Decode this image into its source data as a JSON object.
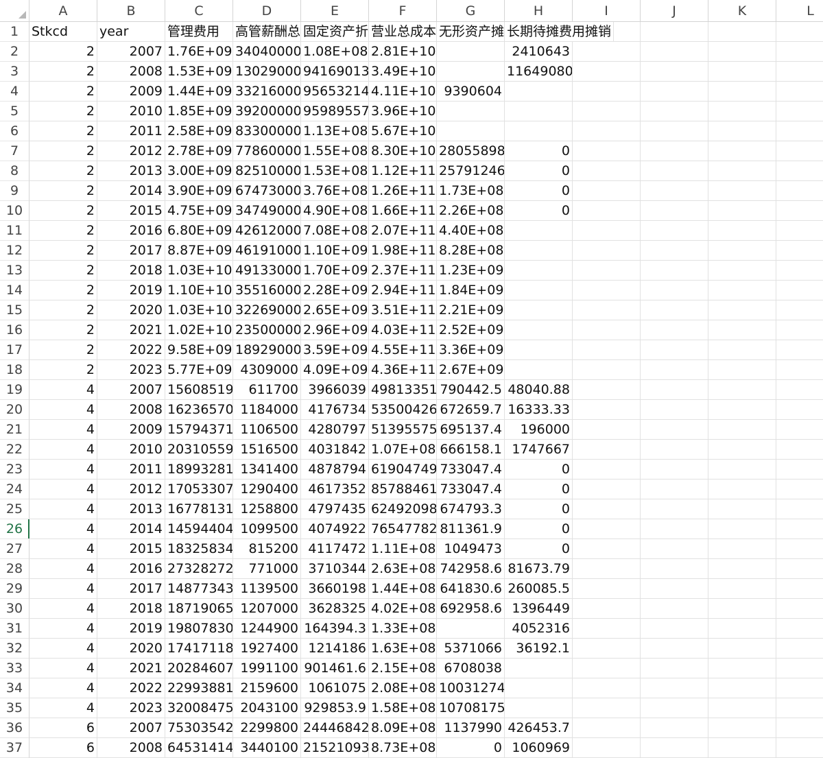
{
  "spreadsheet": {
    "columns": [
      "A",
      "B",
      "C",
      "D",
      "E",
      "F",
      "G",
      "H",
      "I",
      "J",
      "K",
      "L"
    ],
    "selected_row": "26",
    "header_row": {
      "row": "1",
      "cells": [
        "Stkcd",
        "year",
        "管理费用",
        "高管薪酬总额",
        "固定资产折旧",
        "营业总成本",
        "无形资产摊销",
        "长期待摊费用摊销",
        "",
        "",
        "",
        ""
      ]
    },
    "rows": [
      {
        "row": "2",
        "cells": [
          "2",
          "2007",
          "1.76E+09",
          "34040000",
          "1.08E+08",
          "2.81E+10",
          "",
          "2410643",
          "",
          "",
          "",
          ""
        ]
      },
      {
        "row": "3",
        "cells": [
          "2",
          "2008",
          "1.53E+09",
          "13029000",
          "94169013",
          "3.49E+10",
          "",
          "11649080",
          "",
          "",
          "",
          ""
        ]
      },
      {
        "row": "4",
        "cells": [
          "2",
          "2009",
          "1.44E+09",
          "33216000",
          "95653214",
          "4.11E+10",
          "9390604",
          "",
          "",
          "",
          "",
          ""
        ]
      },
      {
        "row": "5",
        "cells": [
          "2",
          "2010",
          "1.85E+09",
          "39200000",
          "95989557",
          "3.96E+10",
          "",
          "",
          "",
          "",
          "",
          ""
        ]
      },
      {
        "row": "6",
        "cells": [
          "2",
          "2011",
          "2.58E+09",
          "83300000",
          "1.13E+08",
          "5.67E+10",
          "",
          "",
          "",
          "",
          "",
          ""
        ]
      },
      {
        "row": "7",
        "cells": [
          "2",
          "2012",
          "2.78E+09",
          "77860000",
          "1.55E+08",
          "8.30E+10",
          "28055898",
          "0",
          "",
          "",
          "",
          ""
        ]
      },
      {
        "row": "8",
        "cells": [
          "2",
          "2013",
          "3.00E+09",
          "82510000",
          "1.53E+08",
          "1.12E+11",
          "25791246",
          "0",
          "",
          "",
          "",
          ""
        ]
      },
      {
        "row": "9",
        "cells": [
          "2",
          "2014",
          "3.90E+09",
          "67473000",
          "3.76E+08",
          "1.26E+11",
          "1.73E+08",
          "0",
          "",
          "",
          "",
          ""
        ]
      },
      {
        "row": "10",
        "cells": [
          "2",
          "2015",
          "4.75E+09",
          "34749000",
          "4.90E+08",
          "1.66E+11",
          "2.26E+08",
          "0",
          "",
          "",
          "",
          ""
        ]
      },
      {
        "row": "11",
        "cells": [
          "2",
          "2016",
          "6.80E+09",
          "42612000",
          "7.08E+08",
          "2.07E+11",
          "4.40E+08",
          "",
          "",
          "",
          "",
          ""
        ]
      },
      {
        "row": "12",
        "cells": [
          "2",
          "2017",
          "8.87E+09",
          "46191000",
          "1.10E+09",
          "1.98E+11",
          "8.28E+08",
          "",
          "",
          "",
          "",
          ""
        ]
      },
      {
        "row": "13",
        "cells": [
          "2",
          "2018",
          "1.03E+10",
          "49133000",
          "1.70E+09",
          "2.37E+11",
          "1.23E+09",
          "",
          "",
          "",
          "",
          ""
        ]
      },
      {
        "row": "14",
        "cells": [
          "2",
          "2019",
          "1.10E+10",
          "35516000",
          "2.28E+09",
          "2.94E+11",
          "1.84E+09",
          "",
          "",
          "",
          "",
          ""
        ]
      },
      {
        "row": "15",
        "cells": [
          "2",
          "2020",
          "1.03E+10",
          "32269000",
          "2.65E+09",
          "3.51E+11",
          "2.21E+09",
          "",
          "",
          "",
          "",
          ""
        ]
      },
      {
        "row": "16",
        "cells": [
          "2",
          "2021",
          "1.02E+10",
          "23500000",
          "2.96E+09",
          "4.03E+11",
          "2.52E+09",
          "",
          "",
          "",
          "",
          ""
        ]
      },
      {
        "row": "17",
        "cells": [
          "2",
          "2022",
          "9.58E+09",
          "18929000",
          "3.59E+09",
          "4.55E+11",
          "3.36E+09",
          "",
          "",
          "",
          "",
          ""
        ]
      },
      {
        "row": "18",
        "cells": [
          "2",
          "2023",
          "5.77E+09",
          "4309000",
          "4.09E+09",
          "4.36E+11",
          "2.67E+09",
          "",
          "",
          "",
          "",
          ""
        ]
      },
      {
        "row": "19",
        "cells": [
          "4",
          "2007",
          "15608519",
          "611700",
          "3966039",
          "49813351",
          "790442.5",
          "48040.88",
          "",
          "",
          "",
          ""
        ]
      },
      {
        "row": "20",
        "cells": [
          "4",
          "2008",
          "16236570",
          "1184000",
          "4176734",
          "53500426",
          "672659.7",
          "16333.33",
          "",
          "",
          "",
          ""
        ]
      },
      {
        "row": "21",
        "cells": [
          "4",
          "2009",
          "15794371",
          "1106500",
          "4280797",
          "51395575",
          "695137.4",
          "196000",
          "",
          "",
          "",
          ""
        ]
      },
      {
        "row": "22",
        "cells": [
          "4",
          "2010",
          "20310559",
          "1516500",
          "4031842",
          "1.07E+08",
          "666158.1",
          "1747667",
          "",
          "",
          "",
          ""
        ]
      },
      {
        "row": "23",
        "cells": [
          "4",
          "2011",
          "18993281",
          "1341400",
          "4878794",
          "61904749",
          "733047.4",
          "0",
          "",
          "",
          "",
          ""
        ]
      },
      {
        "row": "24",
        "cells": [
          "4",
          "2012",
          "17053307",
          "1290400",
          "4617352",
          "85788461",
          "733047.4",
          "0",
          "",
          "",
          "",
          ""
        ]
      },
      {
        "row": "25",
        "cells": [
          "4",
          "2013",
          "16778131",
          "1258800",
          "4797435",
          "62492098",
          "674793.3",
          "0",
          "",
          "",
          "",
          ""
        ]
      },
      {
        "row": "26",
        "cells": [
          "4",
          "2014",
          "14594404",
          "1099500",
          "4074922",
          "76547782",
          "811361.9",
          "0",
          "",
          "",
          "",
          ""
        ]
      },
      {
        "row": "27",
        "cells": [
          "4",
          "2015",
          "18325834",
          "815200",
          "4117472",
          "1.11E+08",
          "1049473",
          "0",
          "",
          "",
          "",
          ""
        ]
      },
      {
        "row": "28",
        "cells": [
          "4",
          "2016",
          "27328272",
          "771000",
          "3710344",
          "2.63E+08",
          "742958.6",
          "81673.79",
          "",
          "",
          "",
          ""
        ]
      },
      {
        "row": "29",
        "cells": [
          "4",
          "2017",
          "14877343",
          "1139500",
          "3660198",
          "1.44E+08",
          "641830.6",
          "260085.5",
          "",
          "",
          "",
          ""
        ]
      },
      {
        "row": "30",
        "cells": [
          "4",
          "2018",
          "18719065",
          "1207000",
          "3628325",
          "4.02E+08",
          "692958.6",
          "1396449",
          "",
          "",
          "",
          ""
        ]
      },
      {
        "row": "31",
        "cells": [
          "4",
          "2019",
          "19807830",
          "1244900",
          "164394.3",
          "1.33E+08",
          "",
          "4052316",
          "",
          "",
          "",
          ""
        ]
      },
      {
        "row": "32",
        "cells": [
          "4",
          "2020",
          "17417118",
          "1927400",
          "1214186",
          "1.63E+08",
          "5371066",
          "36192.1",
          "",
          "",
          "",
          ""
        ]
      },
      {
        "row": "33",
        "cells": [
          "4",
          "2021",
          "20284607",
          "1991100",
          "901461.6",
          "2.15E+08",
          "6708038",
          "",
          "",
          "",
          "",
          ""
        ]
      },
      {
        "row": "34",
        "cells": [
          "4",
          "2022",
          "22993881",
          "2159600",
          "1061075",
          "2.08E+08",
          "10031274",
          "",
          "",
          "",
          "",
          ""
        ]
      },
      {
        "row": "35",
        "cells": [
          "4",
          "2023",
          "32008475",
          "2043100",
          "929853.9",
          "1.58E+08",
          "10708175",
          "",
          "",
          "",
          "",
          ""
        ]
      },
      {
        "row": "36",
        "cells": [
          "6",
          "2007",
          "75303542",
          "2299800",
          "24446842",
          "8.09E+08",
          "1137990",
          "426453.7",
          "",
          "",
          "",
          ""
        ]
      },
      {
        "row": "37",
        "cells": [
          "6",
          "2008",
          "64531414",
          "3440100",
          "21521093",
          "8.73E+08",
          "0",
          "1060969",
          "",
          "",
          "",
          ""
        ]
      }
    ]
  }
}
